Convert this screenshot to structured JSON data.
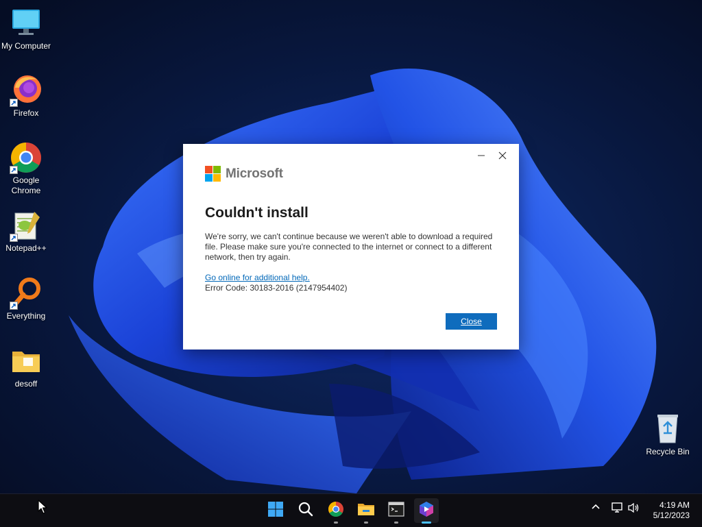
{
  "desktop": {
    "icons": [
      {
        "label": "My Computer",
        "icon": "computer-icon"
      },
      {
        "label": "Firefox",
        "icon": "firefox-icon"
      },
      {
        "label": "Google Chrome",
        "icon": "chrome-icon"
      },
      {
        "label": "Notepad++",
        "icon": "notepadpp-icon"
      },
      {
        "label": "Everything",
        "icon": "everything-icon"
      },
      {
        "label": "desoff",
        "icon": "folder-icon"
      },
      {
        "label": "Recycle Bin",
        "icon": "recycle-bin-icon"
      }
    ]
  },
  "dialog": {
    "brand": "Microsoft",
    "title": "Couldn't install",
    "message": "We're sorry, we can't continue because we weren't able to download a required file.  Please make sure you're connected to the internet or connect to a different network, then try again.",
    "help_link": "Go online for additional help.",
    "error_code": "Error Code: 30183-2016 (2147954402)",
    "close_label": "Close",
    "minimize_icon": "minimize-icon",
    "close_icon": "close-icon"
  },
  "taskbar": {
    "items": [
      "start-icon",
      "search-icon",
      "chrome-icon",
      "file-explorer-icon",
      "terminal-icon",
      "office-setup-icon"
    ],
    "tray": [
      "chevron-up-icon",
      "network-icon",
      "volume-icon"
    ],
    "time": "4:19 AM",
    "date": "5/12/2023"
  },
  "colors": {
    "accent": "#0f6cbd",
    "link": "#0067b8",
    "ms_red": "#f25022",
    "ms_green": "#7fba00",
    "ms_blue": "#00a4ef",
    "ms_yellow": "#ffb900"
  }
}
